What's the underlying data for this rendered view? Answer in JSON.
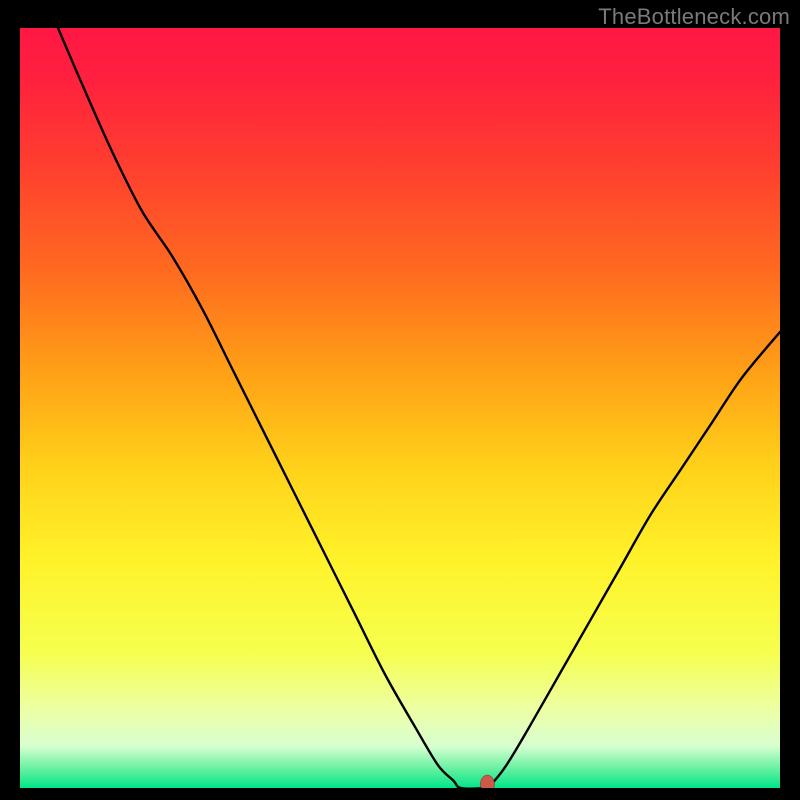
{
  "watermark": "TheBottleneck.com",
  "chart_data": {
    "type": "line",
    "title": "",
    "xlabel": "",
    "ylabel": "",
    "xlim": [
      0,
      100
    ],
    "ylim": [
      100,
      0
    ],
    "gradient_stops": [
      {
        "offset": 0.0,
        "color": "#ff1744"
      },
      {
        "offset": 0.06,
        "color": "#ff1f3f"
      },
      {
        "offset": 0.18,
        "color": "#ff3e2f"
      },
      {
        "offset": 0.32,
        "color": "#ff6a1f"
      },
      {
        "offset": 0.46,
        "color": "#ffa316"
      },
      {
        "offset": 0.58,
        "color": "#ffd21a"
      },
      {
        "offset": 0.7,
        "color": "#fff22a"
      },
      {
        "offset": 0.82,
        "color": "#f6ff4d"
      },
      {
        "offset": 0.9,
        "color": "#ecffa8"
      },
      {
        "offset": 0.945,
        "color": "#d7ffd0"
      },
      {
        "offset": 0.975,
        "color": "#66f0a0"
      },
      {
        "offset": 1.0,
        "color": "#00e588"
      }
    ],
    "curve": [
      {
        "x": 5,
        "y": 100
      },
      {
        "x": 8,
        "y": 93
      },
      {
        "x": 12,
        "y": 84
      },
      {
        "x": 16,
        "y": 76
      },
      {
        "x": 20,
        "y": 70
      },
      {
        "x": 24,
        "y": 63
      },
      {
        "x": 28,
        "y": 55
      },
      {
        "x": 32,
        "y": 47
      },
      {
        "x": 36,
        "y": 39
      },
      {
        "x": 40,
        "y": 31
      },
      {
        "x": 44,
        "y": 23
      },
      {
        "x": 48,
        "y": 15
      },
      {
        "x": 52,
        "y": 8
      },
      {
        "x": 55,
        "y": 3
      },
      {
        "x": 57,
        "y": 1
      },
      {
        "x": 58,
        "y": 0
      },
      {
        "x": 61,
        "y": 0
      },
      {
        "x": 62,
        "y": 0.5
      },
      {
        "x": 64,
        "y": 3
      },
      {
        "x": 67,
        "y": 8
      },
      {
        "x": 71,
        "y": 15
      },
      {
        "x": 75,
        "y": 22
      },
      {
        "x": 79,
        "y": 29
      },
      {
        "x": 83,
        "y": 36
      },
      {
        "x": 87,
        "y": 42
      },
      {
        "x": 91,
        "y": 48
      },
      {
        "x": 95,
        "y": 54
      },
      {
        "x": 100,
        "y": 60
      }
    ],
    "marker": {
      "x": 61.5,
      "y": 0.5,
      "color": "#cc5a4a"
    },
    "curve_color": "#000000",
    "curve_width": 2.4
  }
}
